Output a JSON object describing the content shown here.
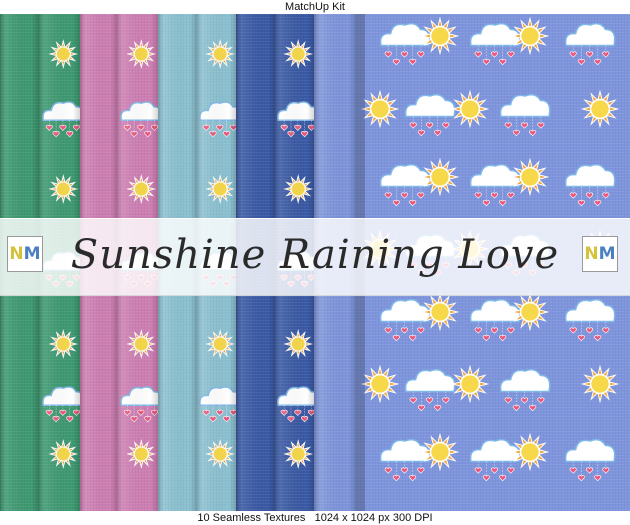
{
  "header": {
    "caption": "MatchUp Kit"
  },
  "banner": {
    "title": "Sunshine Raining Love",
    "logo_text": "NM"
  },
  "footer": {
    "caption": "10 Seamless Textures   1024 x 1024 px 300 DPI"
  },
  "palette": {
    "green": "#3e9a72",
    "pink": "#cf7fb4",
    "light_blue": "#8cc2d2",
    "navy": "#3a5aa6",
    "periwinkle": "#7e95dd",
    "sun": "#f6d84a",
    "sun_ray": "#f2a43a",
    "heart": "#e9597e"
  },
  "swatches": [
    {
      "name": "green-solid",
      "color": "#3e9a72"
    },
    {
      "name": "green-pattern",
      "color": "#3e9a72"
    },
    {
      "name": "pink-solid",
      "color": "#cf7fb4"
    },
    {
      "name": "pink-pattern",
      "color": "#cf7fb4"
    },
    {
      "name": "lightblue-solid",
      "color": "#8cc2d2"
    },
    {
      "name": "lightblue-pattern",
      "color": "#8cc2d2"
    },
    {
      "name": "navy-solid",
      "color": "#3a5aa6"
    },
    {
      "name": "navy-pattern",
      "color": "#3a5aa6"
    },
    {
      "name": "periwinkle-solid",
      "color": "#7e95dd"
    },
    {
      "name": "periwinkle-pattern",
      "color": "#7e95dd"
    }
  ]
}
